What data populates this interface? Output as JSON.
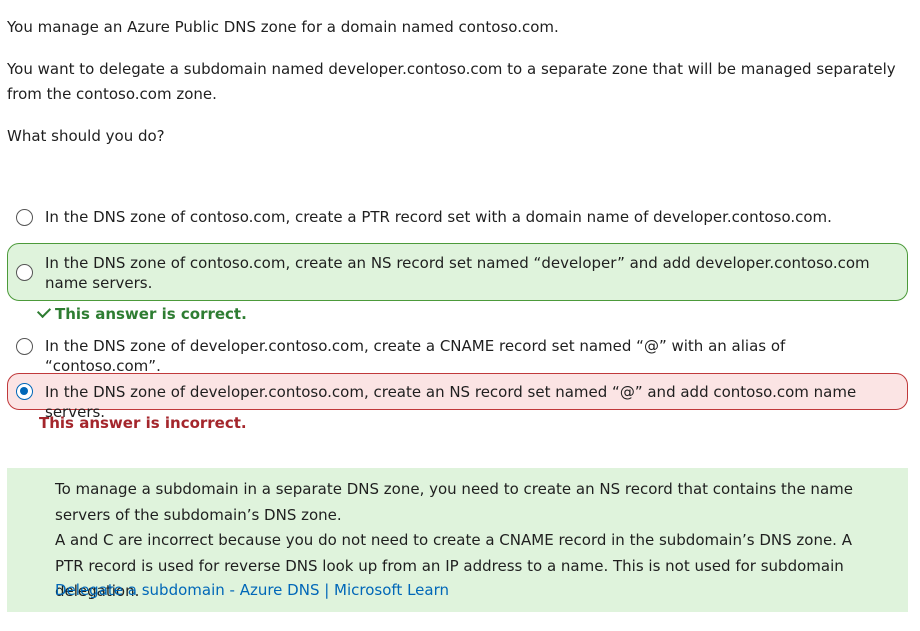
{
  "question": {
    "intro": "You manage an Azure Public DNS zone for a domain named contoso.com.",
    "scenario": "You want to delegate a subdomain named developer.contoso.com to a separate zone that will be managed separately from the contoso.com zone.",
    "prompt": "What should you do?"
  },
  "options": [
    {
      "text": "In the DNS zone of contoso.com, create a PTR record set with a domain name of developer.contoso.com.",
      "selected": false,
      "state": "neutral"
    },
    {
      "text": "In the DNS zone of contoso.com, create an NS record set named “developer” and add developer.contoso.com name servers.",
      "selected": false,
      "state": "correct",
      "feedback": "This answer is correct."
    },
    {
      "text": "In the DNS zone of developer.contoso.com, create a CNAME record set named “@” with an alias of “contoso.com”.",
      "selected": false,
      "state": "neutral"
    },
    {
      "text": "In the DNS zone of developer.contoso.com, create an NS record set named “@” and add contoso.com name servers.",
      "selected": true,
      "state": "incorrect",
      "feedback": "This answer is incorrect."
    }
  ],
  "explanation": {
    "line1": "To manage a subdomain in a separate DNS zone, you need to create an NS record that contains the name servers of the subdomain’s DNS zone.",
    "line2": "A and C are incorrect because you do not need to create a CNAME record in the subdomain’s DNS zone. A PTR record is used for reverse DNS look up from an IP address to a name. This is not used for subdomain delegation.",
    "link_text": "Delegate a subdomain - Azure DNS | Microsoft Learn"
  },
  "colors": {
    "correct_bg": "#dff3dc",
    "correct_border": "#4c9a3a",
    "incorrect_bg": "#fbe4e4",
    "incorrect_border": "#c0393b",
    "link": "#0067b8",
    "radio_selected": "#0067b8"
  }
}
